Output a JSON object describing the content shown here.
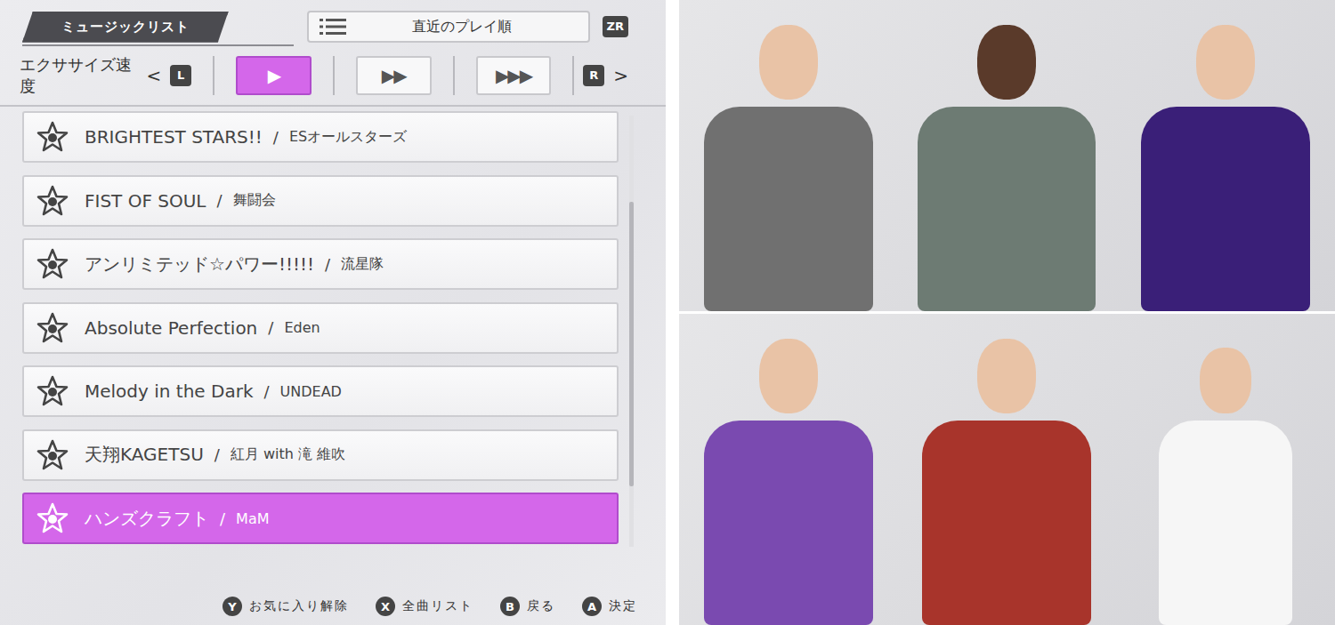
{
  "header": {
    "title": "ミュージックリスト",
    "sort": {
      "label": "直近のプレイ順",
      "key": "ZR"
    }
  },
  "speed": {
    "label": "エクササイズ速度",
    "prev_arrow": "<",
    "prev_key": "L",
    "next_key": "R",
    "next_arrow": ">",
    "options": [
      {
        "label": "▶",
        "selected": true
      },
      {
        "label": "▶▶",
        "selected": false
      },
      {
        "label": "▶▶▶",
        "selected": false
      }
    ]
  },
  "separator": "/",
  "songs": [
    {
      "title": "BRIGHTEST STARS!!",
      "artist": "ESオールスターズ",
      "selected": false
    },
    {
      "title": "FIST OF SOUL",
      "artist": "舞闘会",
      "selected": false
    },
    {
      "title": "アンリミテッド☆パワー!!!!!",
      "artist": "流星隊",
      "selected": false
    },
    {
      "title": "Absolute Perfection",
      "artist": "Eden",
      "selected": false
    },
    {
      "title": "Melody in the Dark",
      "artist": "UNDEAD",
      "selected": false
    },
    {
      "title": "天翔KAGETSU",
      "artist": "紅月 with 滝 維吹",
      "selected": false
    },
    {
      "title": "ハンズクラフト",
      "artist": "MaM",
      "selected": true
    }
  ],
  "scrollbar": {
    "start": 0.2,
    "level": 0.66
  },
  "hints": [
    {
      "key": "Y",
      "label": "お気に入り解除"
    },
    {
      "key": "X",
      "label": "全曲リスト"
    },
    {
      "key": "B",
      "label": "戻る"
    },
    {
      "key": "A",
      "label": "決定"
    }
  ]
}
